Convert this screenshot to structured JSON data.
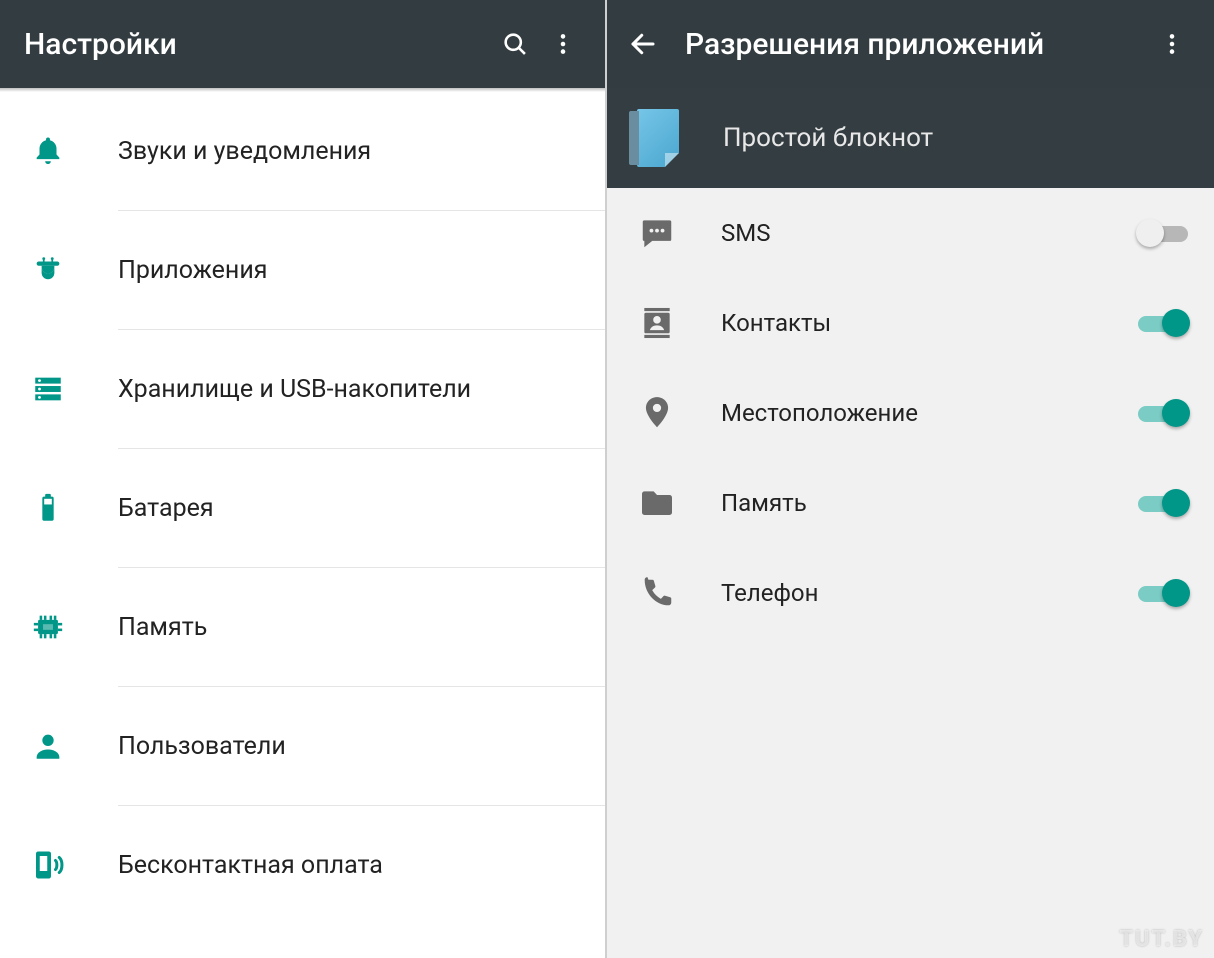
{
  "colors": {
    "accent": "#009688",
    "appbar": "#333d41",
    "icon_gray": "#6a6a6a"
  },
  "watermark": "TUT.BY",
  "left": {
    "title": "Настройки",
    "items": [
      {
        "icon": "bell-icon",
        "label": "Звуки и уведомления"
      },
      {
        "icon": "apps-icon",
        "label": "Приложения"
      },
      {
        "icon": "storage-icon",
        "label": "Хранилище и USB-накопители"
      },
      {
        "icon": "battery-icon",
        "label": "Батарея"
      },
      {
        "icon": "memory-icon",
        "label": "Память"
      },
      {
        "icon": "user-icon",
        "label": "Пользователи"
      },
      {
        "icon": "nfc-icon",
        "label": "Бесконтактная оплата"
      }
    ]
  },
  "right": {
    "title": "Разрешения приложений",
    "app_name": "Простой блокнот",
    "permissions": [
      {
        "icon": "sms-icon",
        "label": "SMS",
        "enabled": false
      },
      {
        "icon": "contacts-icon",
        "label": "Контакты",
        "enabled": true
      },
      {
        "icon": "location-icon",
        "label": "Местоположение",
        "enabled": true
      },
      {
        "icon": "folder-icon",
        "label": "Память",
        "enabled": true
      },
      {
        "icon": "phone-icon",
        "label": "Телефон",
        "enabled": true
      }
    ]
  }
}
